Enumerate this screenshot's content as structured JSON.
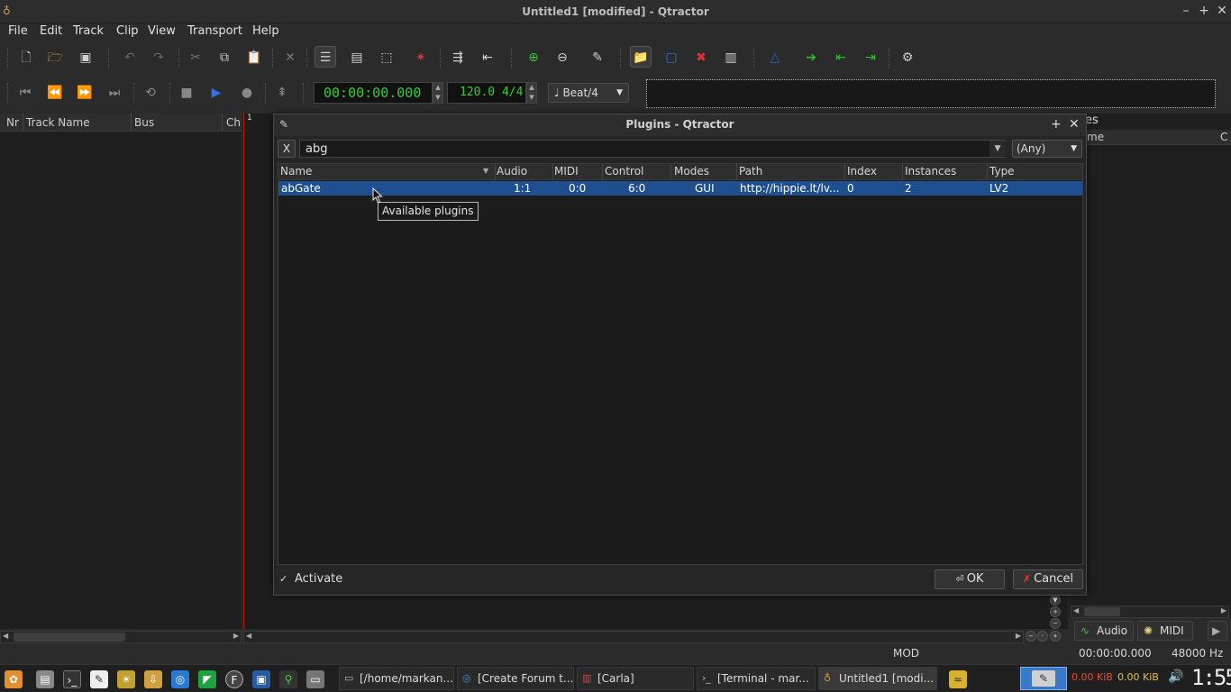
{
  "window": {
    "title": "Untitled1 [modified] - Qtractor"
  },
  "menu": [
    "File",
    "Edit",
    "Track",
    "Clip",
    "View",
    "Transport",
    "Help"
  ],
  "transport": {
    "time": "00:00:00.000",
    "tempo": "120.0 4/4",
    "snap": "Beat/4"
  },
  "tracklist": {
    "columns": [
      "Nr",
      "Track Name",
      "Bus",
      "Ch"
    ]
  },
  "timeline": {
    "bar_marker": "1"
  },
  "right_panel": {
    "title": "es",
    "columns": [
      "me",
      "C"
    ],
    "tabs": [
      "Audio",
      "MIDI"
    ]
  },
  "statusbar": {
    "mode": "MOD",
    "time": "00:00:00.000",
    "rate": "48000 Hz"
  },
  "dialog": {
    "title": "Plugins - Qtractor",
    "clear_label": "X",
    "search_value": "abg",
    "type_filter": "(Any)",
    "columns": [
      "Name",
      "Audio",
      "MIDI",
      "Control",
      "Modes",
      "Path",
      "Index",
      "Instances",
      "Type"
    ],
    "rows": [
      {
        "name": "abGate",
        "audio": "1:1",
        "midi": "0:0",
        "control": "6:0",
        "modes": "GUI",
        "path": "http://hippie.lt/lv...",
        "index": "0",
        "instances": "2",
        "type": "LV2"
      }
    ],
    "tooltip": "Available plugins",
    "activate_label": "Activate",
    "activate_checked": true,
    "ok_label": "OK",
    "cancel_label": "Cancel"
  },
  "taskbar": {
    "tasks": [
      "[/home/markan...",
      "[Create Forum t...",
      "[Carla]",
      "[Terminal - mar...",
      "Untitled1 [modi..."
    ],
    "net_down": "0.00 KiB",
    "net_up": "0.00 KiB",
    "clock": "1:55"
  }
}
